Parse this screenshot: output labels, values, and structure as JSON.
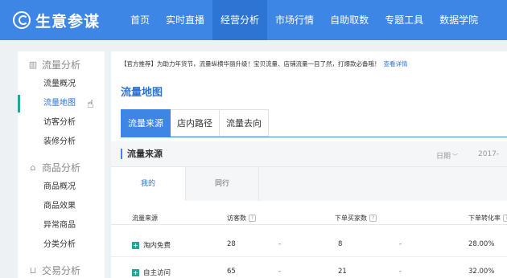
{
  "app": {
    "title": "生意参谋"
  },
  "nav": [
    {
      "label": "首页"
    },
    {
      "label": "实时直播"
    },
    {
      "label": "经营分析"
    },
    {
      "label": "市场行情"
    },
    {
      "label": "自助取数"
    },
    {
      "label": "专题工具"
    },
    {
      "label": "数据学院"
    }
  ],
  "sidebar": {
    "groups": [
      {
        "label": "流量分析",
        "icon": "bar-chart-icon"
      },
      {
        "label": "商品分析",
        "icon": "bag-icon"
      },
      {
        "label": "交易分析",
        "icon": "cart-icon"
      }
    ],
    "items": [
      {
        "label": "流量概况"
      },
      {
        "label": "流量地图"
      },
      {
        "label": "访客分析"
      },
      {
        "label": "装修分析"
      },
      {
        "label": "商品概况"
      },
      {
        "label": "商品效果"
      },
      {
        "label": "异常商品"
      },
      {
        "label": "分类分析"
      }
    ]
  },
  "notice": {
    "text": "【官方推荐】为助力年货节，流量纵横华丽升级！宝贝流量、店铺流量一目了然，打爆款必备哦！",
    "link": "查看详情"
  },
  "page": {
    "title": "流量地图"
  },
  "tabs": [
    {
      "label": "流量来源"
    },
    {
      "label": "店内路径"
    },
    {
      "label": "流量去向"
    }
  ],
  "panel": {
    "title": "流量来源",
    "date_label": "日期",
    "date_value": "2017-"
  },
  "subtabs": [
    {
      "label": "我的"
    },
    {
      "label": "同行"
    }
  ],
  "table": {
    "headers": [
      "流量来源",
      "访客数",
      "下单买家数",
      "下单转化率"
    ],
    "rows": [
      {
        "source": "淘内免费",
        "visitors": "28",
        "v_dash": "-",
        "buyers": "8",
        "b_dash": "-",
        "rate": "28.00%"
      },
      {
        "source": "自主访问",
        "visitors": "65",
        "v_dash": "-",
        "buyers": "21",
        "b_dash": "-",
        "rate": "32.00%"
      }
    ]
  },
  "colors": {
    "brand": "#3d86e6",
    "nav_active": "#2e74d2",
    "accent": "#22a699"
  }
}
